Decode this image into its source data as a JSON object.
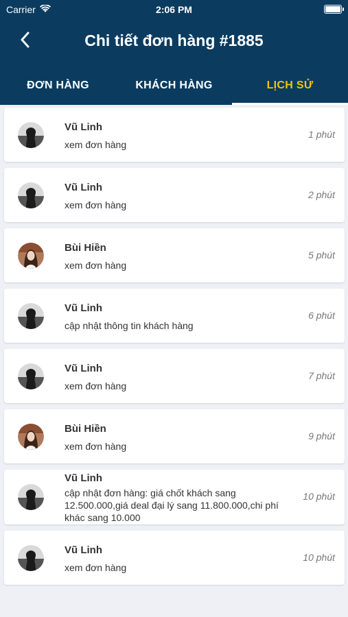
{
  "status_bar": {
    "carrier": "Carrier",
    "time": "2:06 PM"
  },
  "nav": {
    "title": "Chi tiết đơn hàng #1885"
  },
  "tabs": [
    {
      "label": "ĐƠN HÀNG"
    },
    {
      "label": "KHÁCH HÀNG"
    },
    {
      "label": "LỊCH SỬ",
      "active": true
    }
  ],
  "colors": {
    "header_bg": "#0b3c60",
    "active_tab": "#f5c400",
    "page_bg": "#eef0f5"
  },
  "history": [
    {
      "user": "Vũ Linh",
      "action": "xem đơn hàng",
      "time": "1 phút",
      "avatar": "linh"
    },
    {
      "user": "Vũ Linh",
      "action": "xem đơn hàng",
      "time": "2 phút",
      "avatar": "linh"
    },
    {
      "user": "Bùi Hiền",
      "action": "xem đơn hàng",
      "time": "5 phút",
      "avatar": "hien"
    },
    {
      "user": "Vũ Linh",
      "action": "cập nhật thông tin khách hàng",
      "time": "6 phút",
      "avatar": "linh"
    },
    {
      "user": "Vũ Linh",
      "action": "xem đơn hàng",
      "time": "7 phút",
      "avatar": "linh"
    },
    {
      "user": "Bùi Hiền",
      "action": "xem đơn hàng",
      "time": "9 phút",
      "avatar": "hien"
    },
    {
      "user": "Vũ Linh",
      "action": "cập nhật đơn hàng: giá chốt khách sang 12.500.000,giá deal đại lý sang 11.800.000,chi phí khác sang 10.000",
      "time": "10 phút",
      "avatar": "linh"
    },
    {
      "user": "Vũ Linh",
      "action": "xem đơn hàng",
      "time": "10 phút",
      "avatar": "linh"
    }
  ]
}
